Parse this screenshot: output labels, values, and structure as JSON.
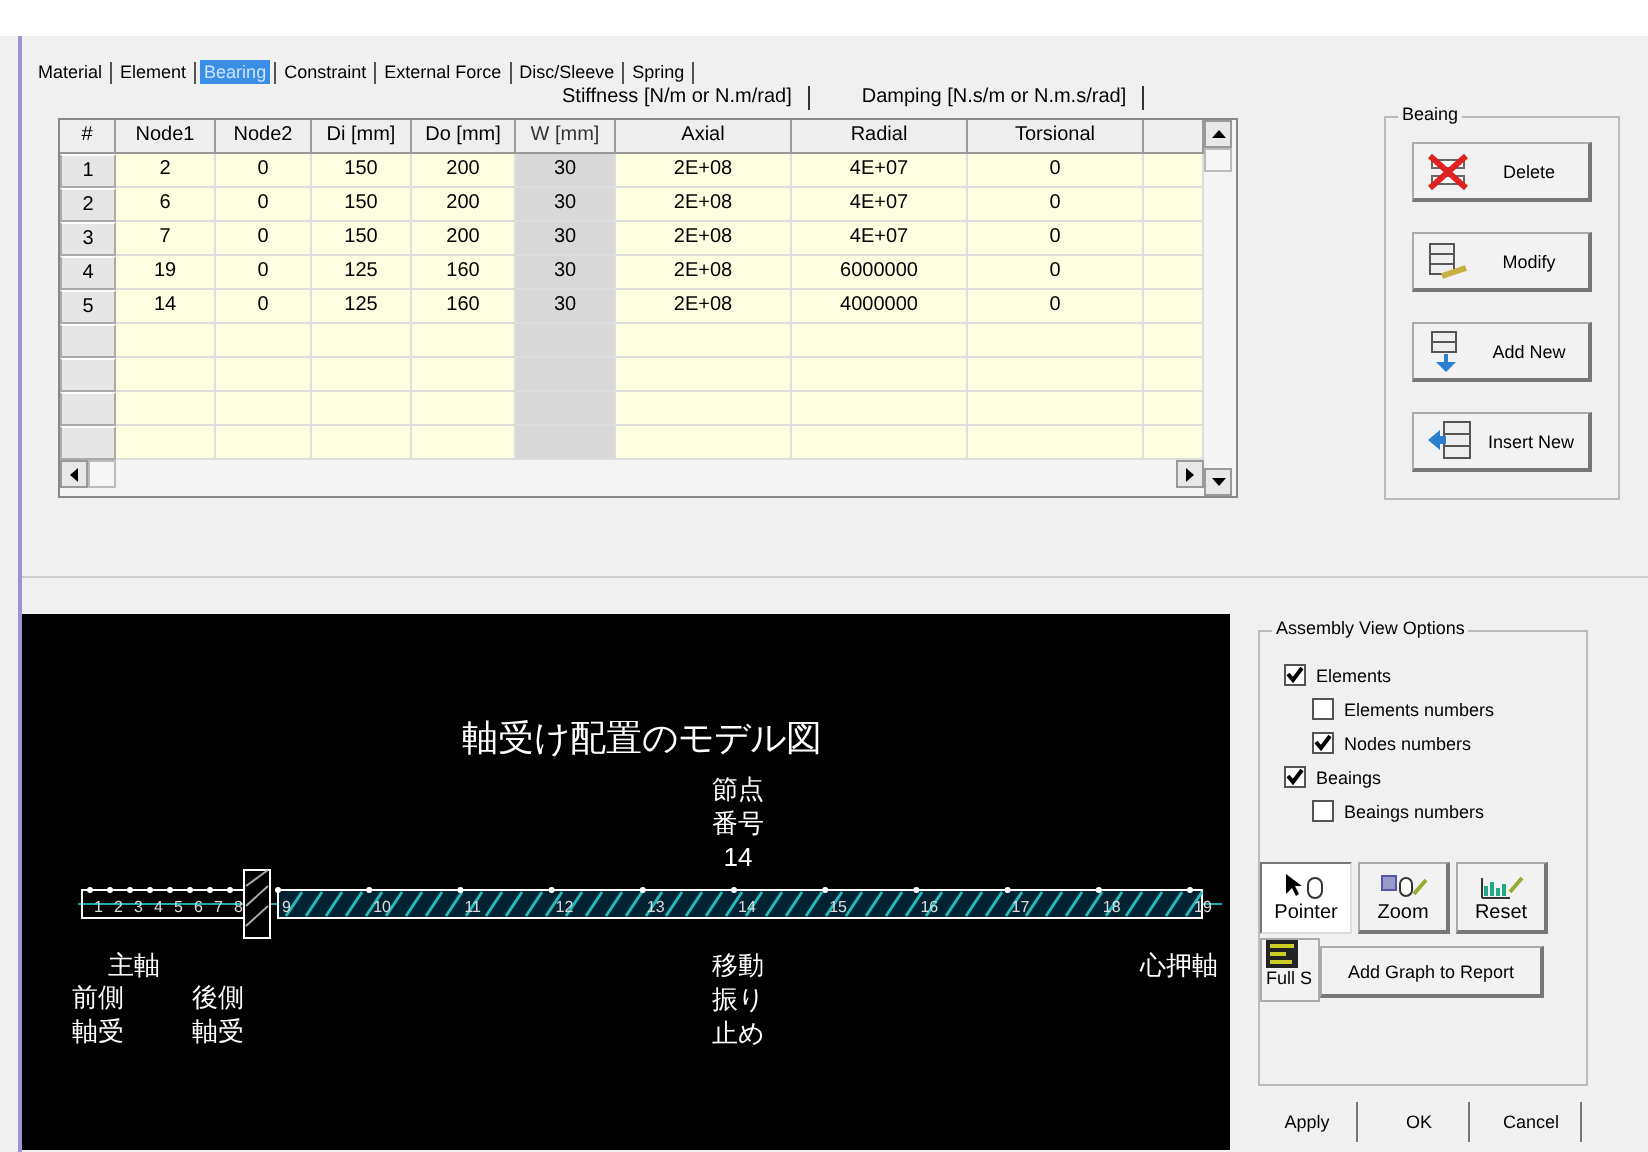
{
  "tabs": [
    {
      "label": "Material",
      "selected": false
    },
    {
      "label": "Element",
      "selected": false
    },
    {
      "label": "Bearing",
      "selected": true
    },
    {
      "label": "Constraint",
      "selected": false
    },
    {
      "label": "External Force",
      "selected": false
    },
    {
      "label": "Disc/Sleeve",
      "selected": false
    },
    {
      "label": "Spring",
      "selected": false
    }
  ],
  "group_headers": [
    "Stiffness [N/m or N.m/rad]",
    "Damping [N.s/m or N.m.s/rad]"
  ],
  "table": {
    "columns": [
      {
        "label": "#",
        "disabled": false
      },
      {
        "label": "Node1",
        "disabled": false
      },
      {
        "label": "Node2",
        "disabled": false
      },
      {
        "label": "Di [mm]",
        "disabled": false
      },
      {
        "label": "Do [mm]",
        "disabled": false
      },
      {
        "label": "W [mm]",
        "disabled": true
      },
      {
        "label": "Axial",
        "disabled": false
      },
      {
        "label": "Radial",
        "disabled": false
      },
      {
        "label": "Torsional",
        "disabled": false
      }
    ],
    "rows": [
      [
        "1",
        "2",
        "0",
        "150",
        "200",
        "30",
        "2E+08",
        "4E+07",
        "0"
      ],
      [
        "2",
        "6",
        "0",
        "150",
        "200",
        "30",
        "2E+08",
        "4E+07",
        "0"
      ],
      [
        "3",
        "7",
        "0",
        "150",
        "200",
        "30",
        "2E+08",
        "4E+07",
        "0"
      ],
      [
        "4",
        "19",
        "0",
        "125",
        "160",
        "30",
        "2E+08",
        "6000000",
        "0"
      ],
      [
        "5",
        "14",
        "0",
        "125",
        "160",
        "30",
        "2E+08",
        "4000000",
        "0"
      ]
    ]
  },
  "bearing_group": {
    "title": "Beaing",
    "buttons": [
      {
        "label": "Delete",
        "kind": "delete"
      },
      {
        "label": "Modify",
        "kind": "modify"
      },
      {
        "label": "Add New",
        "kind": "add"
      },
      {
        "label": "Insert New",
        "kind": "insert"
      }
    ]
  },
  "model_view": {
    "title": "軸受け配置のモデル図",
    "nodes": [
      "1",
      "2",
      "3",
      "4",
      "5",
      "6",
      "7",
      "8",
      "9",
      "10",
      "11",
      "12",
      "13",
      "14",
      "15",
      "16",
      "17",
      "18",
      "19"
    ],
    "labels": [
      {
        "lines": [
          "節点",
          "番号",
          "14"
        ],
        "kind": "above"
      },
      {
        "lines": [
          "主軸"
        ],
        "kind": "below"
      },
      {
        "lines": [
          "前側",
          "軸受"
        ],
        "kind": "below2"
      },
      {
        "lines": [
          "後側",
          "軸受"
        ],
        "kind": "below2"
      },
      {
        "lines": [
          "移動",
          "振り",
          "止め"
        ],
        "kind": "below"
      },
      {
        "lines": [
          "心押軸"
        ],
        "kind": "end"
      }
    ]
  },
  "view_options": {
    "title": "Assembly View Options",
    "options": [
      {
        "label": "Elements",
        "checked": true,
        "children": [
          {
            "label": "Elements numbers",
            "checked": false
          },
          {
            "label": "Nodes numbers",
            "checked": true
          }
        ]
      },
      {
        "label": "Beaings",
        "checked": true,
        "children": [
          {
            "label": "Beaings numbers",
            "checked": false
          }
        ]
      }
    ]
  },
  "tools": [
    {
      "label": "Pointer",
      "kind": "pointer",
      "selected": true
    },
    {
      "label": "Zoom",
      "kind": "zoom",
      "selected": false
    },
    {
      "label": "Reset",
      "kind": "reset",
      "selected": false
    }
  ],
  "full_screen_button": {
    "label": "Full S"
  },
  "add_graph_button": {
    "label": "Add Graph to Report"
  },
  "buttons": [
    "Apply",
    "OK",
    "Cancel"
  ]
}
